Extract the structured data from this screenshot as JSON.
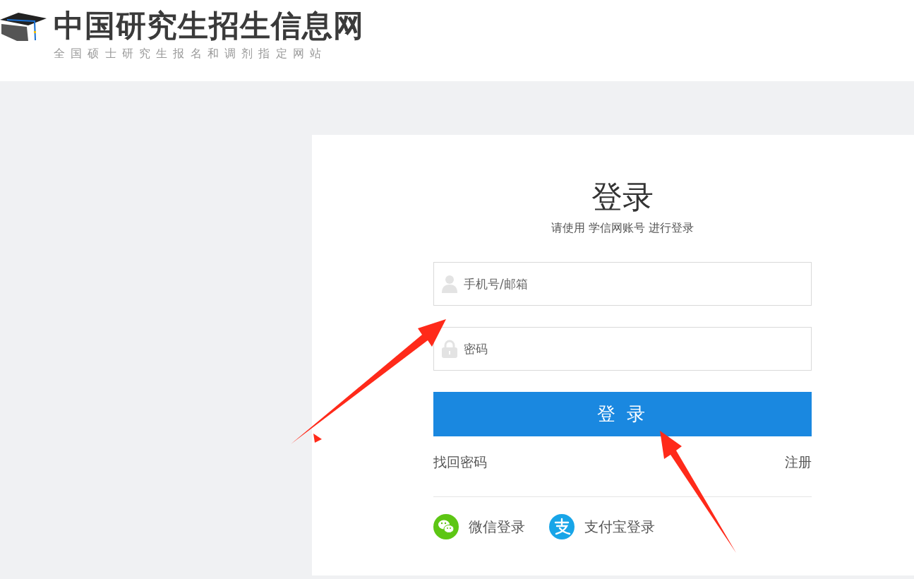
{
  "header": {
    "site_title": "中国研究生招生信息网",
    "tagline": "全国硕士研究生报名和调剂指定网站"
  },
  "login": {
    "title": "登录",
    "subtitle": "请使用 学信网账号 进行登录",
    "fields": [
      {
        "kind": "user",
        "placeholder": "手机号/邮箱"
      },
      {
        "kind": "password",
        "placeholder": "密码"
      }
    ],
    "submit": "登 录",
    "links": [
      "找回密码",
      "注册"
    ],
    "social": [
      {
        "kind": "wechat",
        "label": "微信登录"
      },
      {
        "kind": "alipay",
        "label": "支付宝登录"
      }
    ]
  }
}
